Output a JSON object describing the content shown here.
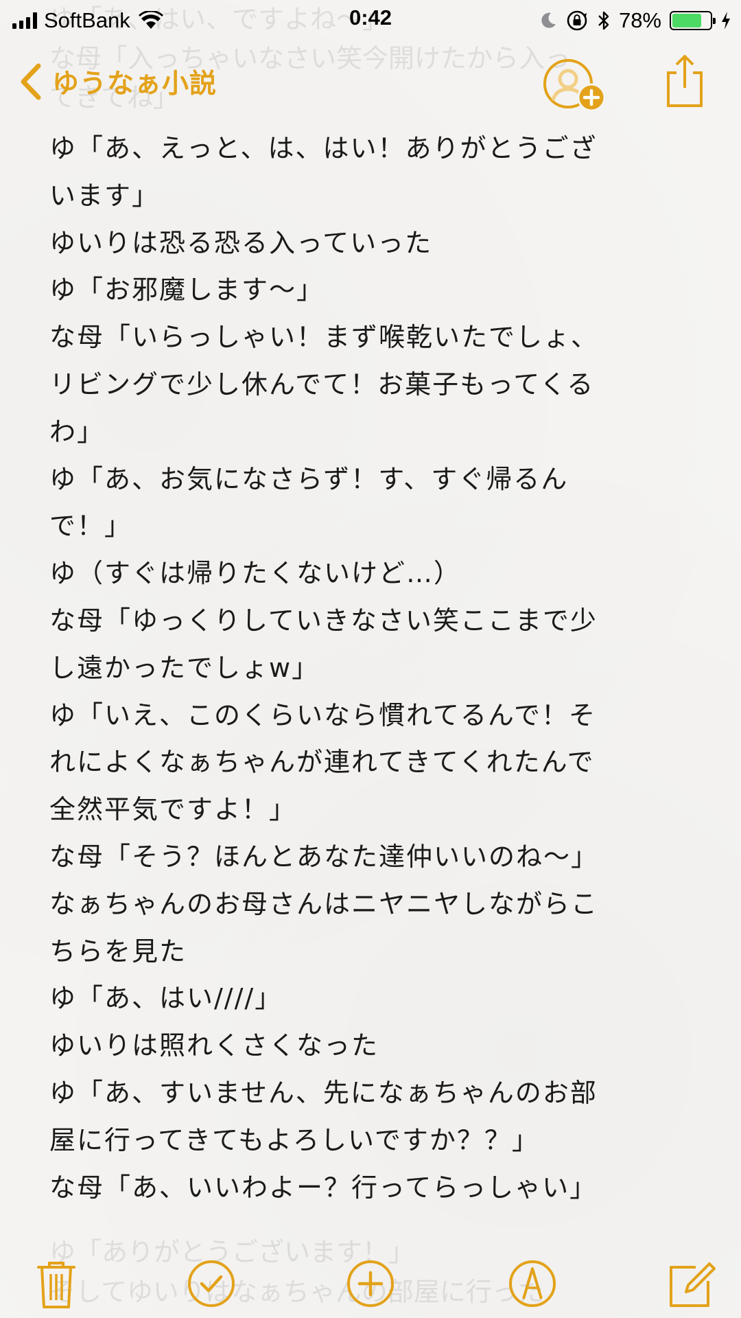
{
  "status_bar": {
    "carrier": "SoftBank",
    "time": "0:42",
    "battery_percent_label": "78%",
    "battery_level": 0.78,
    "battery_color": "#4cd964"
  },
  "nav": {
    "back_label": "ゆうなぁ小説",
    "accent_color": "#e3a21a",
    "back_icon": "chevron-left-icon",
    "add_people_icon": "add-person-icon",
    "share_icon": "share-icon"
  },
  "ghost_top": [
    "ゆ「あ、はい、ですよね〜」",
    "な母「入っちゃいなさい笑今開けたから入っ",
    "てきてね」"
  ],
  "note": {
    "lines": [
      "ゆ「あ、えっと、は、はい！ありがとうござ",
      "います」",
      "ゆいりは恐る恐る入っていった",
      "ゆ「お邪魔します〜」",
      "な母「いらっしゃい！まず喉乾いたでしょ、",
      "リビングで少し休んでて！お菓子もってくる",
      "わ」",
      "ゆ「あ、お気になさらず！す、すぐ帰るん",
      "で！」",
      "ゆ（すぐは帰りたくないけど…）",
      "な母「ゆっくりしていきなさい笑ここまで少",
      "し遠かったでしょw」",
      "ゆ「いえ、このくらいなら慣れてるんで！そ",
      "れによくなぁちゃんが連れてきてくれたんで",
      "全然平気ですよ！」",
      "な母「そう？ほんとあなた達仲いいのね〜」",
      "なぁちゃんのお母さんはニヤニヤしながらこ",
      "ちらを見た",
      "ゆ「あ、はい////」",
      "ゆいりは照れくさくなった",
      "ゆ「あ、すいません、先になぁちゃんのお部",
      "屋に行ってきてもよろしいですか？？」",
      "な母「あ、いいわよー？行ってらっしゃい」"
    ]
  },
  "ghost_bottom": [
    "ゆ「ありがとうございます！」",
    "そしてゆいりはなぁちゃんの部屋に行った"
  ],
  "toolbar": {
    "items": [
      {
        "icon": "trash-icon",
        "name": "delete-button"
      },
      {
        "icon": "checklist-icon",
        "name": "checklist-button"
      },
      {
        "icon": "plus-icon",
        "name": "add-button"
      },
      {
        "icon": "markup-icon",
        "name": "markup-button"
      },
      {
        "icon": "compose-icon",
        "name": "compose-button"
      }
    ]
  }
}
